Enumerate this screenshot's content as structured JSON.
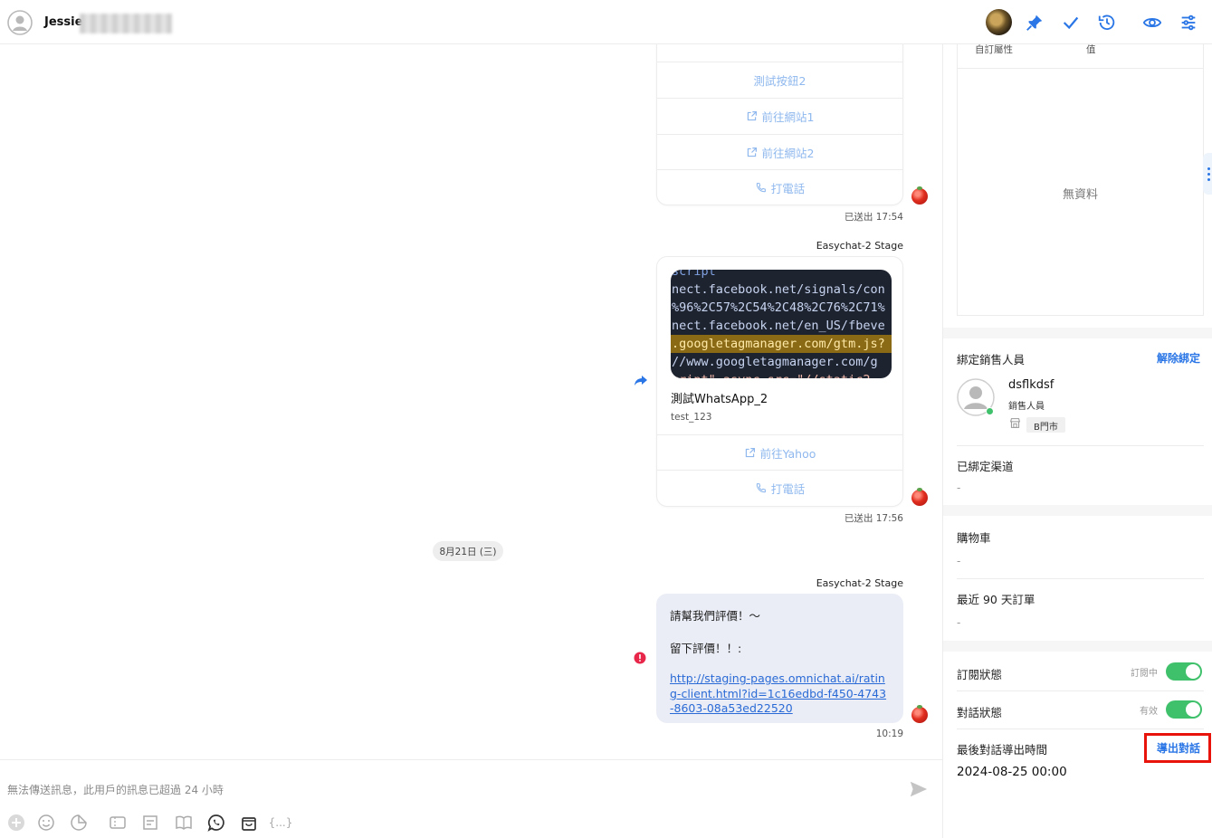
{
  "header": {
    "user_name": "Jessie"
  },
  "messages": {
    "msg1": {
      "buttons": [
        "測試按鈕2",
        "前往網站1",
        "前往網站2",
        "打電話"
      ],
      "status": "已送出 17:54"
    },
    "msg2": {
      "sender": "Easychat-2 Stage",
      "image_code_lines": [
        "script",
        "nect.facebook.net/signals/con",
        "%96%2C57%2C54%2C48%2C76%2C71%",
        "nect.facebook.net/en_US/fbeve",
        ".googletagmanager.com/gtm.js?",
        "//www.googletagmanager.com/g",
        "cript\" async src=\"//static2"
      ],
      "title": "測試WhatsApp_2",
      "subtitle": "test_123",
      "buttons": [
        "前往Yahoo",
        "打電話"
      ],
      "status": "已送出 17:56"
    },
    "date_divider": "8月21日 (三)",
    "msg3": {
      "sender": "Easychat-2 Stage",
      "line1": "請幫我們評價！～",
      "line2": "留下評價！！:",
      "link": "http://staging-pages.omnichat.ai/rating-client.html?id=1c16edbd-f450-4743-8603-08a53ed22520",
      "time": "10:19"
    }
  },
  "composer": {
    "note": "無法傳送訊息，此用戶的訊息已超過 24 小時"
  },
  "panel": {
    "custom_attr_header": "自訂屬性",
    "value_header": "值",
    "no_data": "無資料",
    "bound_sales": {
      "title": "綁定銷售人員",
      "unbind": "解除綁定",
      "name": "dsflkdsf",
      "role": "銷售人員",
      "store": "B門市"
    },
    "bound_channels": {
      "title": "已綁定渠道",
      "value": "-"
    },
    "cart": {
      "title": "購物車",
      "value": "-"
    },
    "recent_orders": {
      "title": "最近 90 天訂單",
      "value": "-"
    },
    "subscription": {
      "title": "訂閱狀態",
      "state": "訂閱中"
    },
    "conversation": {
      "title": "對話狀態",
      "state": "有效"
    },
    "export": {
      "title": "最後對話導出時間",
      "button": "導出對話",
      "value": "2024-08-25 00:00"
    }
  },
  "colors": {
    "accent": "#2a76e6",
    "toggle_on": "#3fc06a",
    "highlight_box": "#e8140c",
    "light_button_text": "#8fb8ee",
    "rating_bubble_bg": "#eaedf5"
  }
}
